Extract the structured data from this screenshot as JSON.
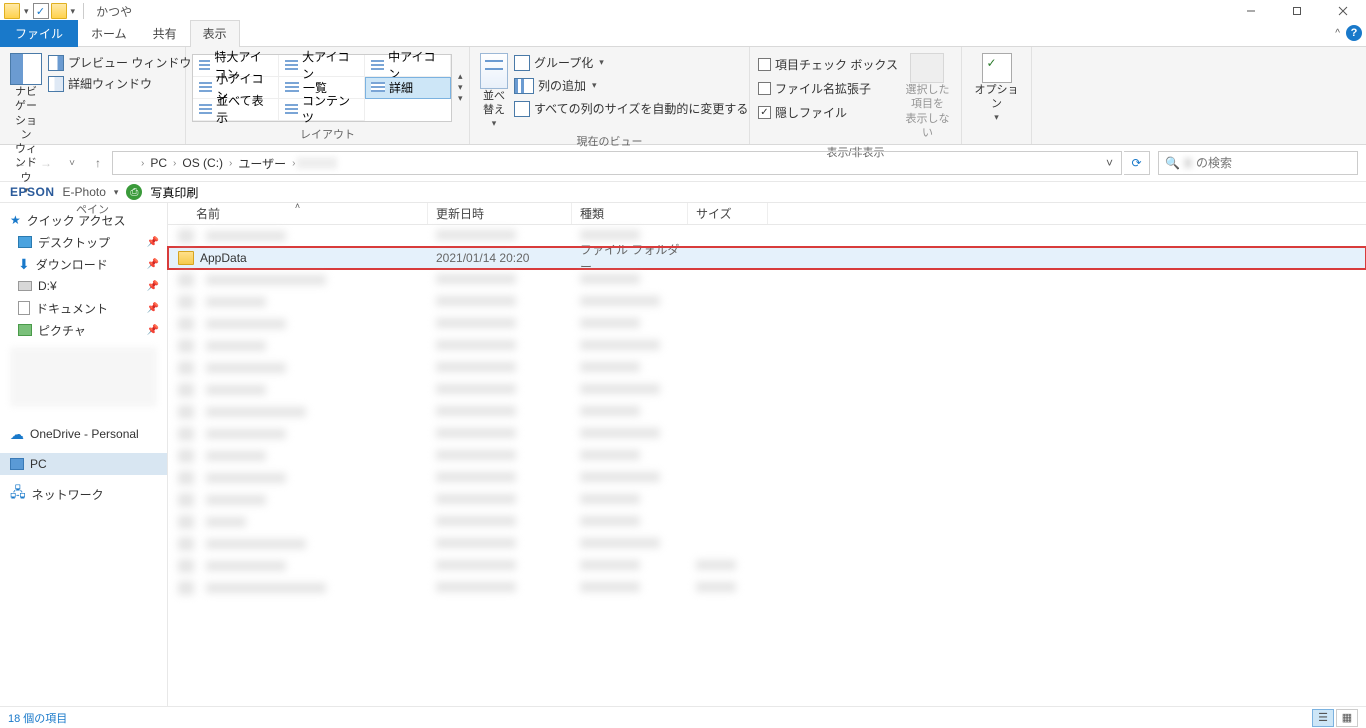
{
  "titlebar": {
    "title": "かつや"
  },
  "window_controls": {
    "minimize": "–",
    "maximize": "☐",
    "close": "✕"
  },
  "tabs": {
    "file": "ファイル",
    "home": "ホーム",
    "share": "共有",
    "view": "表示"
  },
  "ribbon": {
    "panes": {
      "nav": "ナビゲーション\nウィンドウ",
      "preview": "プレビュー ウィンドウ",
      "details": "詳細ウィンドウ",
      "label": "ペイン"
    },
    "layout": {
      "xl": "特大アイコン",
      "l": "大アイコン",
      "m": "中アイコン",
      "s": "小アイコン",
      "list": "一覧",
      "details": "詳細",
      "tiles": "並べて表示",
      "content": "コンテンツ",
      "label": "レイアウト"
    },
    "currentview": {
      "sort": "並べ替え",
      "group": "グループ化",
      "addcol": "列の追加",
      "autosize": "すべての列のサイズを自動的に変更する",
      "label": "現在のビュー"
    },
    "showhide": {
      "itemcheck": "項目チェック ボックス",
      "ext": "ファイル名拡張子",
      "hidden": "隠しファイル",
      "hidesel": "選択した項目を\n表示しない",
      "label": "表示/非表示"
    },
    "options": "オプション"
  },
  "breadcrumb": {
    "pc": "PC",
    "drive": "OS (C:)",
    "users": "ユーザー"
  },
  "search": {
    "placeholder": "の検索"
  },
  "epson": {
    "brand": "EPSON",
    "app": "E-Photo",
    "print": "写真印刷"
  },
  "tree": {
    "quick": "クイック アクセス",
    "desktop": "デスクトップ",
    "downloads": "ダウンロード",
    "ddrive": "D:¥",
    "documents": "ドキュメント",
    "pictures": "ピクチャ",
    "onedrive": "OneDrive - Personal",
    "pc": "PC",
    "network": "ネットワーク"
  },
  "columns": {
    "name": "名前",
    "date": "更新日時",
    "type": "種類",
    "size": "サイズ"
  },
  "row_highlight": {
    "name": "AppData",
    "date": "2021/01/14 20:20",
    "type": "ファイル フォルダー"
  },
  "status": {
    "count": "18 個の項目"
  }
}
